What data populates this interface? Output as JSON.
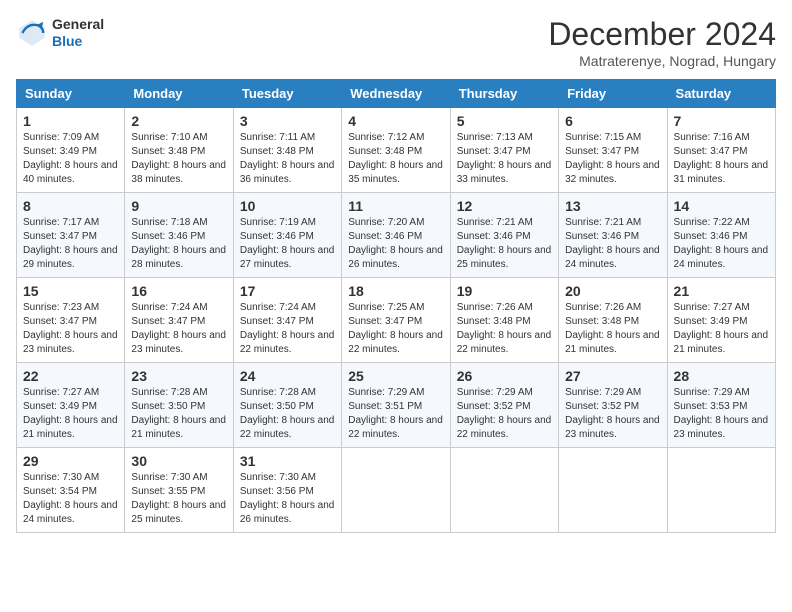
{
  "header": {
    "logo_general": "General",
    "logo_blue": "Blue",
    "month_title": "December 2024",
    "location": "Matraterenye, Nograd, Hungary"
  },
  "days_of_week": [
    "Sunday",
    "Monday",
    "Tuesday",
    "Wednesday",
    "Thursday",
    "Friday",
    "Saturday"
  ],
  "weeks": [
    [
      {
        "day": "1",
        "sunrise": "7:09 AM",
        "sunset": "3:49 PM",
        "daylight": "8 hours and 40 minutes."
      },
      {
        "day": "2",
        "sunrise": "7:10 AM",
        "sunset": "3:48 PM",
        "daylight": "8 hours and 38 minutes."
      },
      {
        "day": "3",
        "sunrise": "7:11 AM",
        "sunset": "3:48 PM",
        "daylight": "8 hours and 36 minutes."
      },
      {
        "day": "4",
        "sunrise": "7:12 AM",
        "sunset": "3:48 PM",
        "daylight": "8 hours and 35 minutes."
      },
      {
        "day": "5",
        "sunrise": "7:13 AM",
        "sunset": "3:47 PM",
        "daylight": "8 hours and 33 minutes."
      },
      {
        "day": "6",
        "sunrise": "7:15 AM",
        "sunset": "3:47 PM",
        "daylight": "8 hours and 32 minutes."
      },
      {
        "day": "7",
        "sunrise": "7:16 AM",
        "sunset": "3:47 PM",
        "daylight": "8 hours and 31 minutes."
      }
    ],
    [
      {
        "day": "8",
        "sunrise": "7:17 AM",
        "sunset": "3:47 PM",
        "daylight": "8 hours and 29 minutes."
      },
      {
        "day": "9",
        "sunrise": "7:18 AM",
        "sunset": "3:46 PM",
        "daylight": "8 hours and 28 minutes."
      },
      {
        "day": "10",
        "sunrise": "7:19 AM",
        "sunset": "3:46 PM",
        "daylight": "8 hours and 27 minutes."
      },
      {
        "day": "11",
        "sunrise": "7:20 AM",
        "sunset": "3:46 PM",
        "daylight": "8 hours and 26 minutes."
      },
      {
        "day": "12",
        "sunrise": "7:21 AM",
        "sunset": "3:46 PM",
        "daylight": "8 hours and 25 minutes."
      },
      {
        "day": "13",
        "sunrise": "7:21 AM",
        "sunset": "3:46 PM",
        "daylight": "8 hours and 24 minutes."
      },
      {
        "day": "14",
        "sunrise": "7:22 AM",
        "sunset": "3:46 PM",
        "daylight": "8 hours and 24 minutes."
      }
    ],
    [
      {
        "day": "15",
        "sunrise": "7:23 AM",
        "sunset": "3:47 PM",
        "daylight": "8 hours and 23 minutes."
      },
      {
        "day": "16",
        "sunrise": "7:24 AM",
        "sunset": "3:47 PM",
        "daylight": "8 hours and 23 minutes."
      },
      {
        "day": "17",
        "sunrise": "7:24 AM",
        "sunset": "3:47 PM",
        "daylight": "8 hours and 22 minutes."
      },
      {
        "day": "18",
        "sunrise": "7:25 AM",
        "sunset": "3:47 PM",
        "daylight": "8 hours and 22 minutes."
      },
      {
        "day": "19",
        "sunrise": "7:26 AM",
        "sunset": "3:48 PM",
        "daylight": "8 hours and 22 minutes."
      },
      {
        "day": "20",
        "sunrise": "7:26 AM",
        "sunset": "3:48 PM",
        "daylight": "8 hours and 21 minutes."
      },
      {
        "day": "21",
        "sunrise": "7:27 AM",
        "sunset": "3:49 PM",
        "daylight": "8 hours and 21 minutes."
      }
    ],
    [
      {
        "day": "22",
        "sunrise": "7:27 AM",
        "sunset": "3:49 PM",
        "daylight": "8 hours and 21 minutes."
      },
      {
        "day": "23",
        "sunrise": "7:28 AM",
        "sunset": "3:50 PM",
        "daylight": "8 hours and 21 minutes."
      },
      {
        "day": "24",
        "sunrise": "7:28 AM",
        "sunset": "3:50 PM",
        "daylight": "8 hours and 22 minutes."
      },
      {
        "day": "25",
        "sunrise": "7:29 AM",
        "sunset": "3:51 PM",
        "daylight": "8 hours and 22 minutes."
      },
      {
        "day": "26",
        "sunrise": "7:29 AM",
        "sunset": "3:52 PM",
        "daylight": "8 hours and 22 minutes."
      },
      {
        "day": "27",
        "sunrise": "7:29 AM",
        "sunset": "3:52 PM",
        "daylight": "8 hours and 23 minutes."
      },
      {
        "day": "28",
        "sunrise": "7:29 AM",
        "sunset": "3:53 PM",
        "daylight": "8 hours and 23 minutes."
      }
    ],
    [
      {
        "day": "29",
        "sunrise": "7:30 AM",
        "sunset": "3:54 PM",
        "daylight": "8 hours and 24 minutes."
      },
      {
        "day": "30",
        "sunrise": "7:30 AM",
        "sunset": "3:55 PM",
        "daylight": "8 hours and 25 minutes."
      },
      {
        "day": "31",
        "sunrise": "7:30 AM",
        "sunset": "3:56 PM",
        "daylight": "8 hours and 26 minutes."
      },
      null,
      null,
      null,
      null
    ]
  ],
  "labels": {
    "sunrise": "Sunrise:",
    "sunset": "Sunset:",
    "daylight": "Daylight:"
  }
}
